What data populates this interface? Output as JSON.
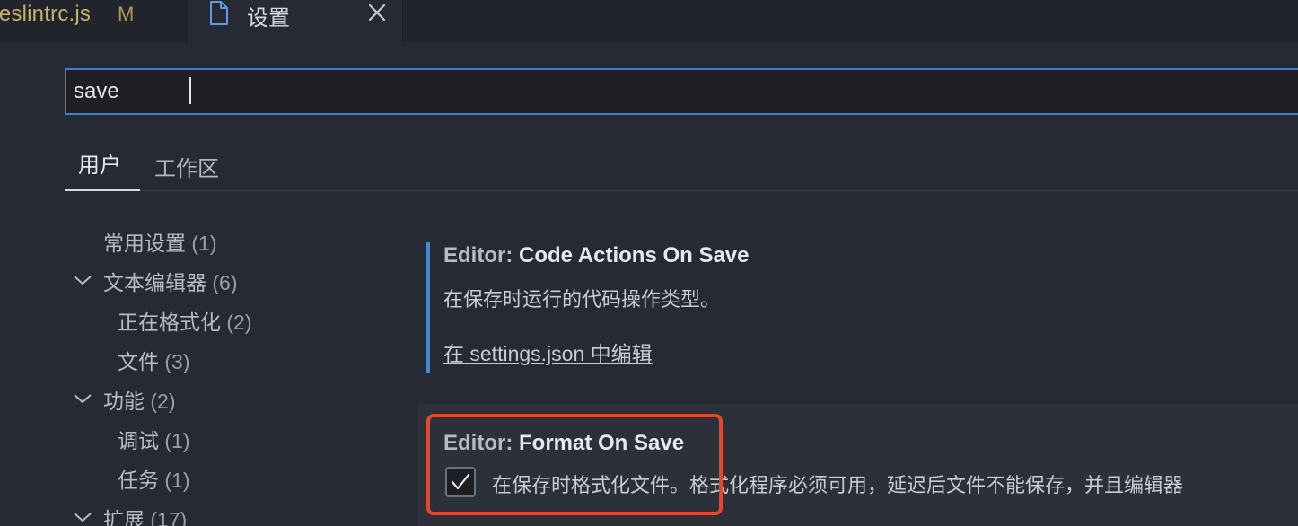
{
  "tabs": [
    {
      "label": ".eslintrc.js",
      "modified_badge": "M",
      "active": false
    },
    {
      "label": "设置",
      "active": true
    }
  ],
  "search": {
    "value": "save",
    "placeholder": ""
  },
  "scope_tabs": [
    {
      "label": "用户",
      "active": true
    },
    {
      "label": "工作区",
      "active": false
    }
  ],
  "toc": [
    {
      "label": "常用设置",
      "count": "(1)",
      "level": 0,
      "expandable": false
    },
    {
      "label": "文本编辑器",
      "count": "(6)",
      "level": 0,
      "expandable": true
    },
    {
      "label": "正在格式化",
      "count": "(2)",
      "level": 1,
      "expandable": false
    },
    {
      "label": "文件",
      "count": "(3)",
      "level": 1,
      "expandable": false
    },
    {
      "label": "功能",
      "count": "(2)",
      "level": 0,
      "expandable": true
    },
    {
      "label": "调试",
      "count": "(1)",
      "level": 1,
      "expandable": false
    },
    {
      "label": "任务",
      "count": "(1)",
      "level": 1,
      "expandable": false
    },
    {
      "label": "扩展",
      "count": "(17)",
      "level": 0,
      "expandable": true
    }
  ],
  "settings": [
    {
      "category": "Editor: ",
      "name": "Code Actions On Save",
      "description": "在保存时运行的代码操作类型。",
      "link": "在 settings.json 中编辑"
    },
    {
      "category": "Editor: ",
      "name": "Format On Save",
      "description": "在保存时格式化文件。格式化程序必须可用，延迟后文件不能保存，并且编辑器",
      "checked": true
    }
  ],
  "colors": {
    "accent_blue": "#3d7fd6",
    "highlight_red": "#e0482f",
    "modified_gold": "#c9b16b"
  },
  "icons": [
    "file-icon",
    "close-icon",
    "chevron-down-icon",
    "check-icon"
  ]
}
